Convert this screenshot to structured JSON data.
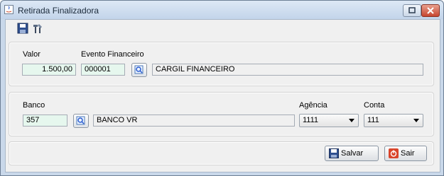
{
  "window": {
    "title": "Retirada Finalizadora"
  },
  "toolbar": {
    "icons": [
      "save-icon",
      "tools-icon"
    ]
  },
  "finance_group": {
    "valor_label": "Valor",
    "valor_value": "1.500,00",
    "evento_label": "Evento Financeiro",
    "evento_code": "000001",
    "evento_name": "CARGIL FINANCEIRO"
  },
  "bank_group": {
    "banco_label": "Banco",
    "banco_code": "357",
    "banco_name": "BANCO VR",
    "agencia_label": "Agência",
    "agencia_value": "1111",
    "conta_label": "Conta",
    "conta_value": "111"
  },
  "actions": {
    "save_label": "Salvar",
    "exit_label": "Sair"
  },
  "colors": {
    "editable_bg": "#e6f7ee",
    "close_red": "#c6452f"
  }
}
